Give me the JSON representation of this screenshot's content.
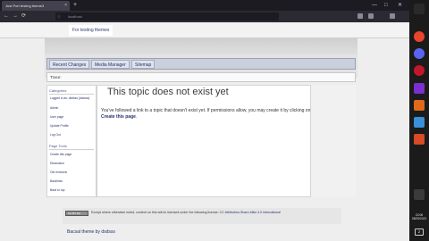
{
  "browser": {
    "tab_title": "Just Port testing theme3",
    "tab_close": "×",
    "new_tab": "+",
    "url": "localhost",
    "window_min": "—",
    "window_max": "□",
    "window_close": "✕",
    "back": "←",
    "forward": "→",
    "reload": "⟳"
  },
  "site": {
    "title": "For testing themes"
  },
  "menu": {
    "items": [
      "Recent Changes",
      "Media Manager",
      "Sitemap"
    ]
  },
  "trace": "Trace:",
  "sidebar": {
    "categories_heading": "Categories",
    "user_items": [
      "Logged in as: dsdsss (dsdsss)",
      "Admin",
      "User page",
      "Update Profile",
      "Log Out"
    ],
    "tools_heading": "Page Tools",
    "tool_items": [
      "Create this page",
      "Discussion",
      "Old revisions",
      "Backlinks",
      "Back to top"
    ]
  },
  "content": {
    "title": "This topic does not exist yet",
    "body": "You've followed a link to a topic that doesn't exist yet. If permissions allow, you may create it by clicking on",
    "create_link": "Create this page",
    "body_end": "."
  },
  "footer": {
    "badge": "CC BY-SA",
    "text": "Except where otherwise noted, content on this wiki is licensed under the following license:",
    "license_link": "CC Attribution-Share Alike 4.0 International",
    "theme_credit": "Bacsal theme by dsdsss"
  },
  "taskbar": {
    "time": "22:06",
    "date": "28/09/2021",
    "notify": "2"
  },
  "colors": {
    "link": "#26306b",
    "menubar": "#cbd0dd",
    "browser_bg": "#2b2a33"
  }
}
